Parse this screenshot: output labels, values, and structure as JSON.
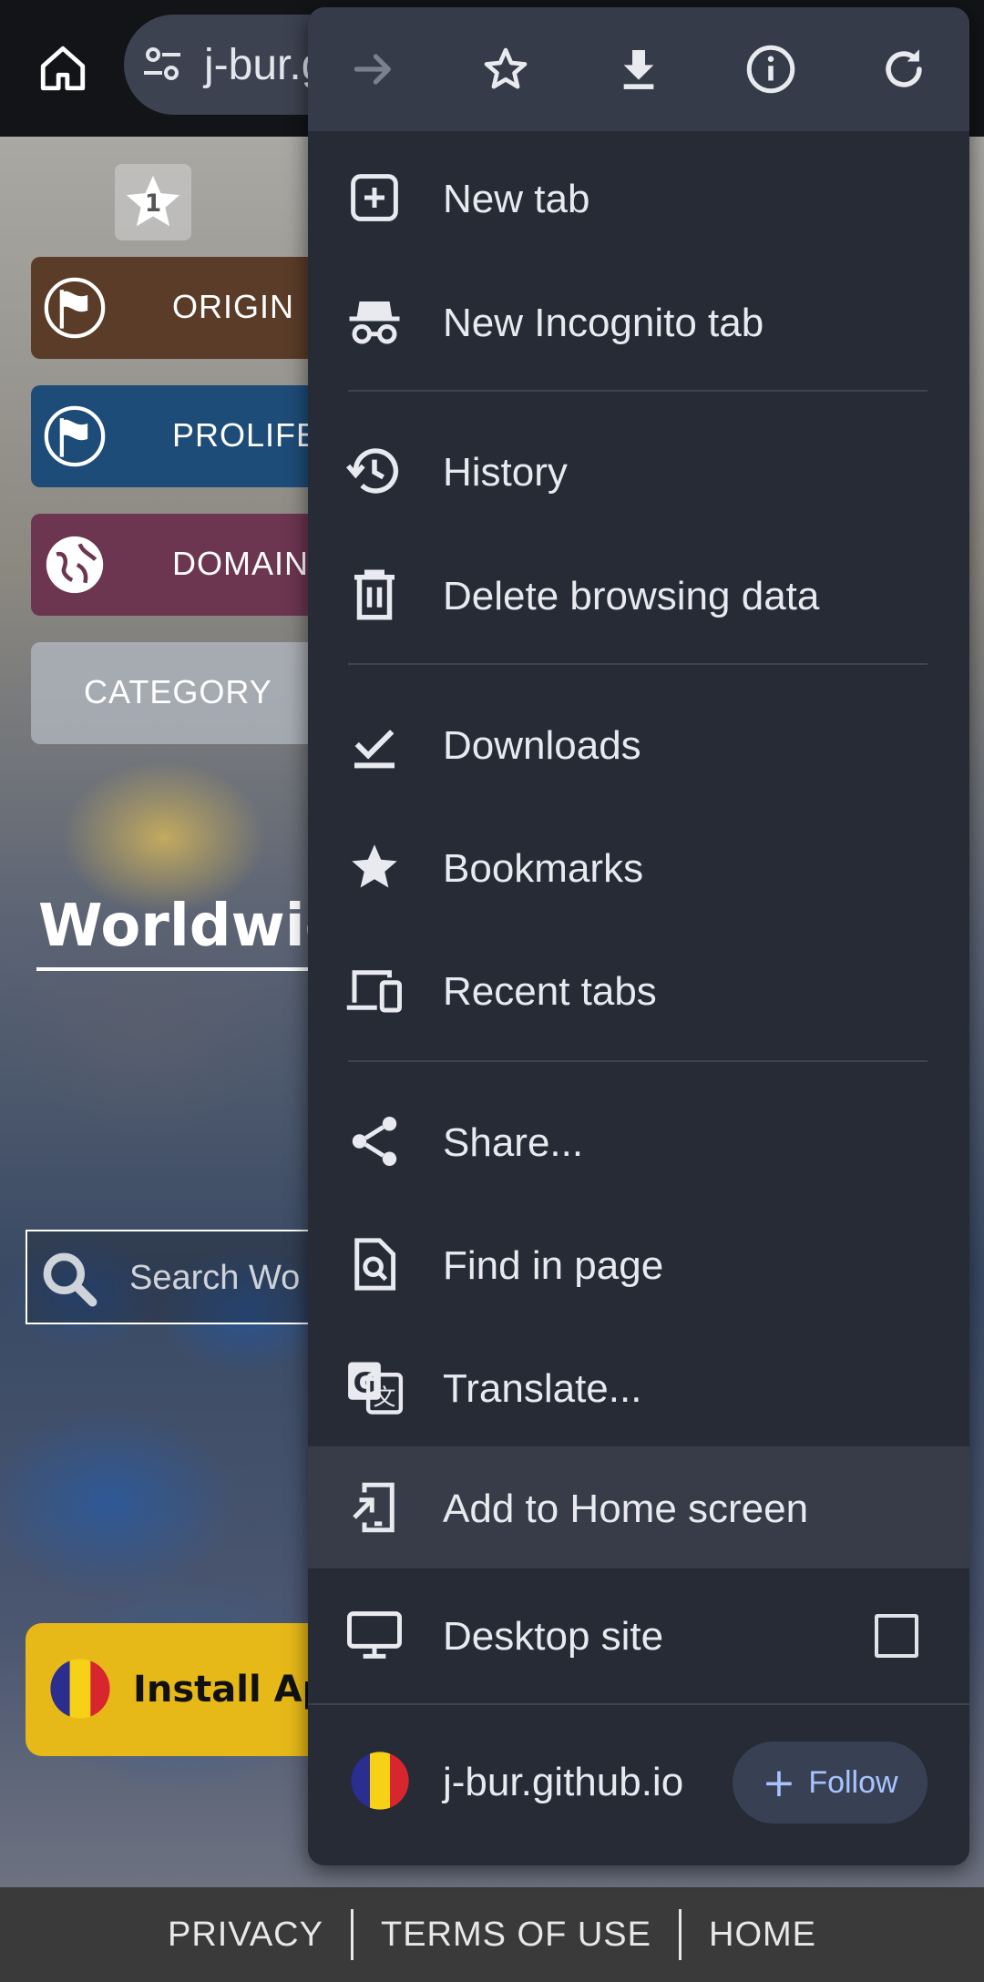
{
  "browser": {
    "url_text": "j-bur.g"
  },
  "page": {
    "nav_buttons": [
      {
        "label": "ORIGIN"
      },
      {
        "label": "PROLIFE"
      },
      {
        "label": "DOMAIN"
      },
      {
        "label": "CATEGORY"
      }
    ],
    "title": "Worldwic",
    "search_placeholder": "Search Wo",
    "install_label": "Install Ap",
    "footer": {
      "privacy": "PRIVACY",
      "terms": "TERMS OF USE",
      "home": "HOME"
    }
  },
  "menu": {
    "toolbar_icons": [
      "forward-icon",
      "star-icon",
      "download-icon",
      "info-icon",
      "refresh-icon"
    ],
    "items": {
      "new_tab": "New tab",
      "new_incognito_tab": "New Incognito tab",
      "history": "History",
      "delete_browsing_data": "Delete browsing data",
      "downloads": "Downloads",
      "bookmarks": "Bookmarks",
      "recent_tabs": "Recent tabs",
      "share": "Share...",
      "find_in_page": "Find in page",
      "translate": "Translate...",
      "add_to_home_screen": "Add to Home screen",
      "desktop_site": "Desktop site"
    },
    "desktop_site_checked": false,
    "site": {
      "name": "j-bur.github.io",
      "follow_label": "Follow"
    }
  },
  "colors": {
    "menu_bg": "#262b36",
    "menu_header_bg": "#353b48",
    "highlight_bg": "#373c48",
    "follow_accent": "#a8c4ff",
    "install_yellow": "#e7b918"
  }
}
